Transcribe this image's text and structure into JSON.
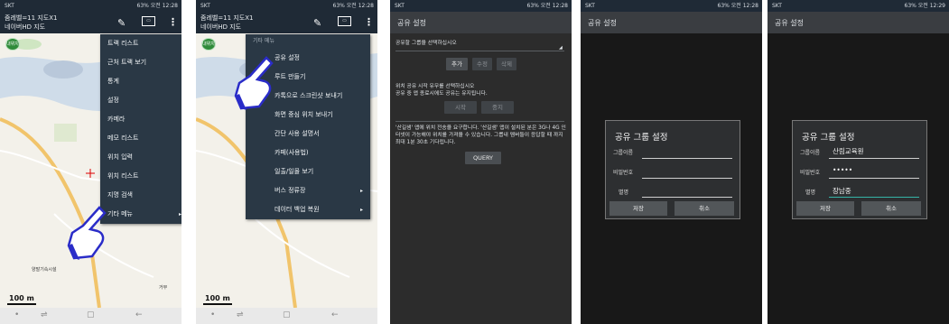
{
  "phone1": {
    "status_left": "SKT",
    "status_right": "63% 오전 12:28",
    "title_line1": "줌레벨=11 지도X1",
    "title_line2": "네이버HD 지도",
    "zoom_circle": "내위치",
    "scale": "100 m",
    "menu": [
      "트랙 리스트",
      "근처 트랙 보기",
      "통계",
      "설정",
      "카메라",
      "메모 리스트",
      "위치 입력",
      "위치 리스트",
      "지명 검색",
      "기타 메뉴"
    ],
    "map_labels": [
      "양말기속시설",
      "거부"
    ]
  },
  "phone2": {
    "status_left": "SKT",
    "status_right": "63% 오전 12:28",
    "title_line1": "줌레벨=11 지도X1",
    "title_line2": "네이버HD 지도",
    "zoom_circle": "내위치",
    "scale": "100 m",
    "submenu_header": "기타 메뉴",
    "submenu": [
      "공유 설정",
      "루트 만들기",
      "카톡으로 스크린샷 보내기",
      "화면 중심 위치 보내기",
      "간단 사용 설명서",
      "카페(사용법)",
      "일출/일몰 보기",
      "버스 정류장",
      "데이터 백업 복원"
    ]
  },
  "phone3": {
    "status_left": "SKT",
    "status_right": "63% 오전 12:28",
    "title": "공유 설정",
    "select_prompt": "공유할 그룹을 선택하십시오",
    "btn_add": "추가",
    "btn_edit": "수정",
    "btn_delete": "삭제",
    "start_line1": "위치 공유 시작 유무를 선택하십시오",
    "start_line2": "공유 중 앱 종료시에도 공유는 유지됩니다.",
    "btn_start": "시작",
    "btn_stop": "중지",
    "info": "'산길샘' 앱에 위치 전송을 요구합니다. '산길샘' 앱이 설치된 분은 3G나 4G 인터넷이 가능해야 위치를 가져올 수 있습니다. 그룹내 멤버들이 응답할 때 까지 최대 1분 30초 기다립니다.",
    "btn_query": "QUERY"
  },
  "phone4": {
    "status_left": "SKT",
    "status_right": "63% 오전 12:28",
    "title": "공유 설정",
    "dialog_title": "공유 그룹 설정",
    "label_group": "그룹이름",
    "label_password": "비밀번호",
    "label_alias": "별명",
    "value_group": "",
    "value_password": "",
    "value_alias": "",
    "btn_save": "저장",
    "btn_cancel": "취소"
  },
  "phone5": {
    "status_left": "SKT",
    "status_right": "63% 오전 12:29",
    "title": "공유 설정",
    "dialog_title": "공유 그룹 설정",
    "label_group": "그룹이름",
    "label_password": "비밀번호",
    "label_alias": "별명",
    "value_group": "산림교육원",
    "value_password": "•••••",
    "value_alias": "장남중",
    "btn_save": "저장",
    "btn_cancel": "취소"
  },
  "colors": {
    "appbar": "#1f2a36",
    "menu_bg": "#2a3845",
    "dialog_accent": "#35b5a8",
    "hand_blue": "#2a2cc8"
  }
}
